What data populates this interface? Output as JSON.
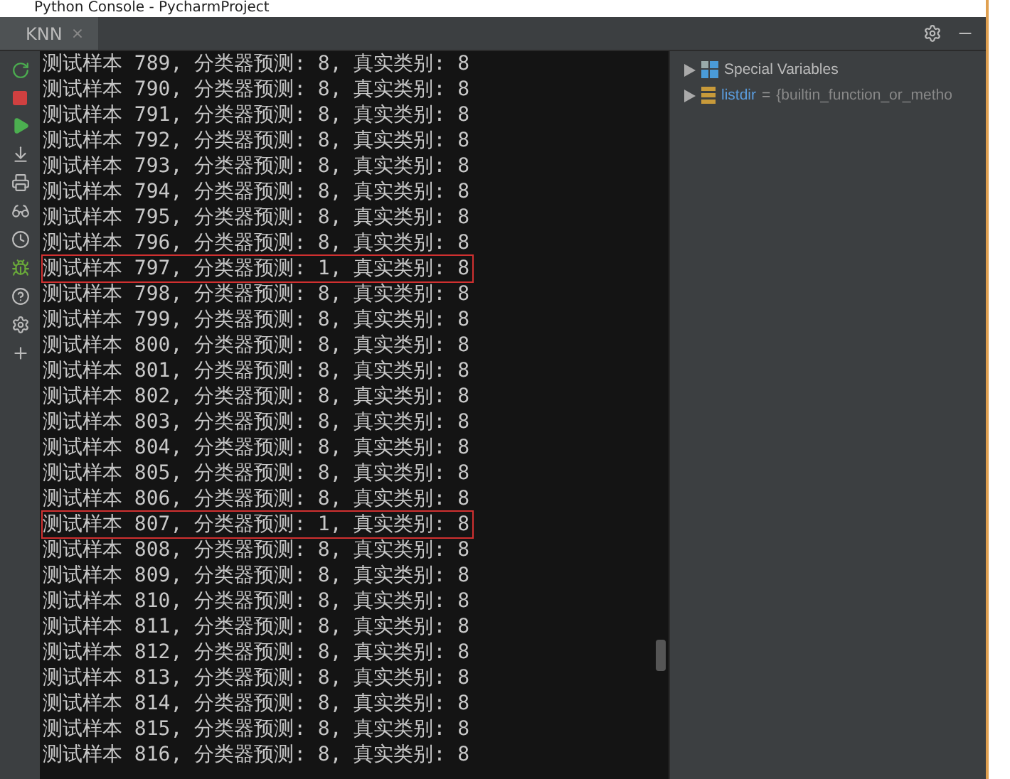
{
  "window": {
    "title": "Python Console - PycharmProject"
  },
  "tabs": [
    {
      "label": "KNN",
      "close": "×",
      "selected": true
    }
  ],
  "console": {
    "lines": [
      {
        "text": "测试样本 789, 分类器预测: 8, 真实类别: 8",
        "highlighted": false
      },
      {
        "text": "测试样本 790, 分类器预测: 8, 真实类别: 8",
        "highlighted": false
      },
      {
        "text": "测试样本 791, 分类器预测: 8, 真实类别: 8",
        "highlighted": false
      },
      {
        "text": "测试样本 792, 分类器预测: 8, 真实类别: 8",
        "highlighted": false
      },
      {
        "text": "测试样本 793, 分类器预测: 8, 真实类别: 8",
        "highlighted": false
      },
      {
        "text": "测试样本 794, 分类器预测: 8, 真实类别: 8",
        "highlighted": false
      },
      {
        "text": "测试样本 795, 分类器预测: 8, 真实类别: 8",
        "highlighted": false
      },
      {
        "text": "测试样本 796, 分类器预测: 8, 真实类别: 8",
        "highlighted": false
      },
      {
        "text": "测试样本 797, 分类器预测: 1, 真实类别: 8",
        "highlighted": true
      },
      {
        "text": "测试样本 798, 分类器预测: 8, 真实类别: 8",
        "highlighted": false
      },
      {
        "text": "测试样本 799, 分类器预测: 8, 真实类别: 8",
        "highlighted": false
      },
      {
        "text": "测试样本 800, 分类器预测: 8, 真实类别: 8",
        "highlighted": false
      },
      {
        "text": "测试样本 801, 分类器预测: 8, 真实类别: 8",
        "highlighted": false
      },
      {
        "text": "测试样本 802, 分类器预测: 8, 真实类别: 8",
        "highlighted": false
      },
      {
        "text": "测试样本 803, 分类器预测: 8, 真实类别: 8",
        "highlighted": false
      },
      {
        "text": "测试样本 804, 分类器预测: 8, 真实类别: 8",
        "highlighted": false
      },
      {
        "text": "测试样本 805, 分类器预测: 8, 真实类别: 8",
        "highlighted": false
      },
      {
        "text": "测试样本 806, 分类器预测: 8, 真实类别: 8",
        "highlighted": false
      },
      {
        "text": "测试样本 807, 分类器预测: 1, 真实类别: 8",
        "highlighted": true
      },
      {
        "text": "测试样本 808, 分类器预测: 8, 真实类别: 8",
        "highlighted": false
      },
      {
        "text": "测试样本 809, 分类器预测: 8, 真实类别: 8",
        "highlighted": false
      },
      {
        "text": "测试样本 810, 分类器预测: 8, 真实类别: 8",
        "highlighted": false
      },
      {
        "text": "测试样本 811, 分类器预测: 8, 真实类别: 8",
        "highlighted": false
      },
      {
        "text": "测试样本 812, 分类器预测: 8, 真实类别: 8",
        "highlighted": false
      },
      {
        "text": "测试样本 813, 分类器预测: 8, 真实类别: 8",
        "highlighted": false
      },
      {
        "text": "测试样本 814, 分类器预测: 8, 真实类别: 8",
        "highlighted": false
      },
      {
        "text": "测试样本 815, 分类器预测: 8, 真实类别: 8",
        "highlighted": false
      },
      {
        "text": "测试样本 816, 分类器预测: 8, 真实类别: 8",
        "highlighted": false
      }
    ]
  },
  "variables": [
    {
      "kind": "group",
      "name": "Special Variables"
    },
    {
      "kind": "variable",
      "name": "listdir",
      "operator": "=",
      "value": "{builtin_function_or_metho"
    }
  ]
}
